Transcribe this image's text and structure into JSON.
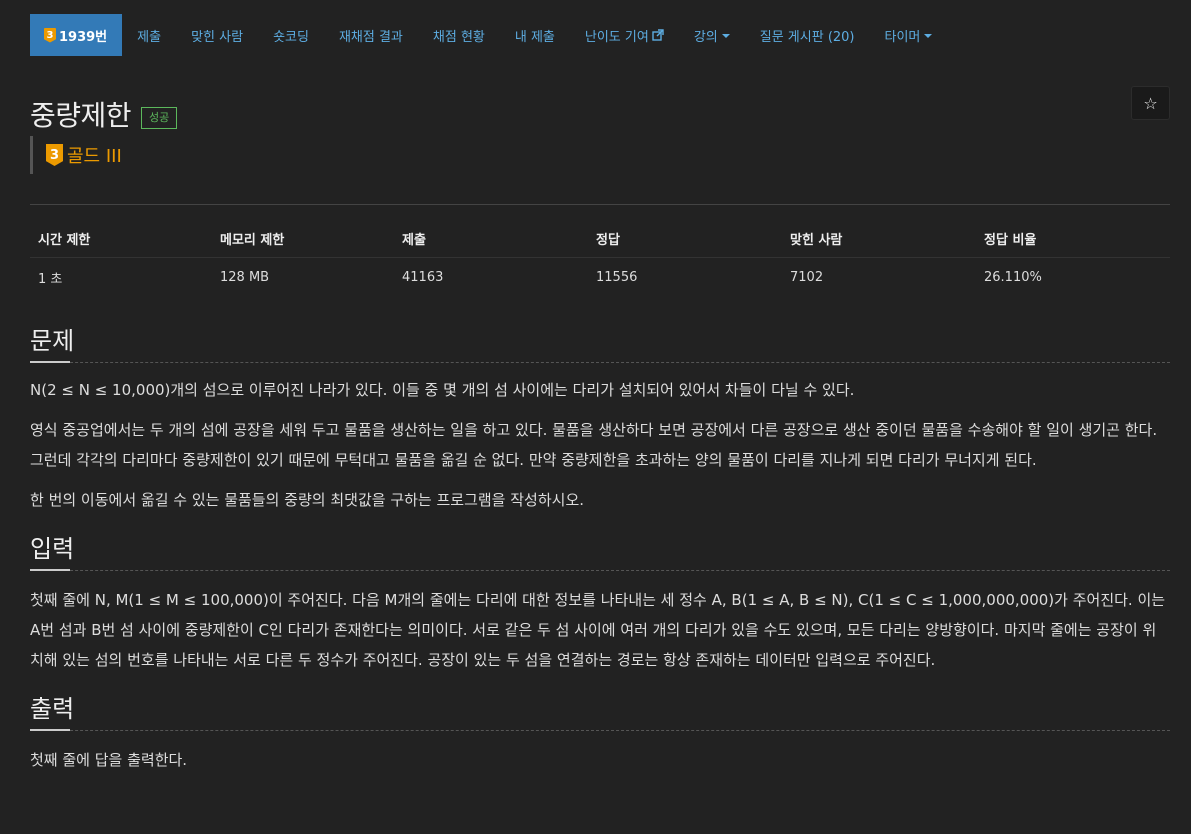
{
  "nav": {
    "problem_badge": "3",
    "problem_number": "1939번",
    "items": [
      "제출",
      "맞힌 사람",
      "숏코딩",
      "재채점 결과",
      "채점 현황",
      "내 제출",
      "난이도 기여",
      "강의",
      "질문 게시판 (20)",
      "타이머"
    ]
  },
  "problem": {
    "title": "중량제한",
    "status": "성공",
    "tier_badge": "3",
    "tier_name": "골드 III"
  },
  "info_table": {
    "headers": [
      "시간 제한",
      "메모리 제한",
      "제출",
      "정답",
      "맞힌 사람",
      "정답 비율"
    ],
    "values": [
      "1 초",
      "128 MB",
      "41163",
      "11556",
      "7102",
      "26.110%"
    ]
  },
  "sections": {
    "description": {
      "heading": "문제",
      "paragraphs": [
        "N(2 ≤ N ≤ 10,000)개의 섬으로 이루어진 나라가 있다. 이들 중 몇 개의 섬 사이에는 다리가 설치되어 있어서 차들이 다닐 수 있다.",
        "영식 중공업에서는 두 개의 섬에 공장을 세워 두고 물품을 생산하는 일을 하고 있다. 물품을 생산하다 보면 공장에서 다른 공장으로 생산 중이던 물품을 수송해야 할 일이 생기곤 한다. 그런데 각각의 다리마다 중량제한이 있기 때문에 무턱대고 물품을 옮길 순 없다. 만약 중량제한을 초과하는 양의 물품이 다리를 지나게 되면 다리가 무너지게 된다.",
        "한 번의 이동에서 옮길 수 있는 물품들의 중량의 최댓값을 구하는 프로그램을 작성하시오."
      ]
    },
    "input": {
      "heading": "입력",
      "paragraphs": [
        "첫째 줄에 N, M(1 ≤ M ≤ 100,000)이 주어진다. 다음 M개의 줄에는 다리에 대한 정보를 나타내는 세 정수 A, B(1 ≤ A, B ≤ N), C(1 ≤ C ≤ 1,000,000,000)가 주어진다. 이는 A번 섬과 B번 섬 사이에 중량제한이 C인 다리가 존재한다는 의미이다. 서로 같은 두 섬 사이에 여러 개의 다리가 있을 수도 있으며, 모든 다리는 양방향이다. 마지막 줄에는 공장이 위치해 있는 섬의 번호를 나타내는 서로 다른 두 정수가 주어진다. 공장이 있는 두 섬을 연결하는 경로는 항상 존재하는 데이터만 입력으로 주어진다."
      ]
    },
    "output": {
      "heading": "출력",
      "paragraphs": [
        "첫째 줄에 답을 출력한다."
      ]
    }
  }
}
